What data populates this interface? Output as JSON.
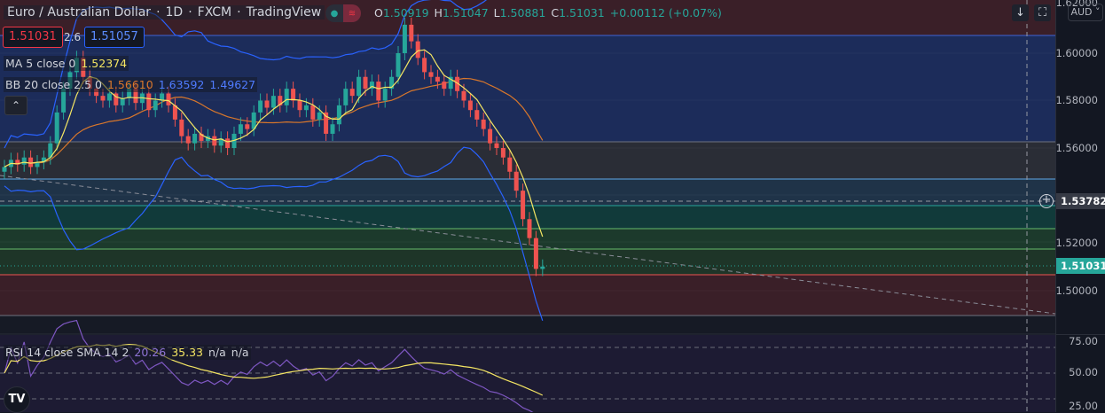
{
  "header": {
    "symbol": "Euro / Australian Dollar",
    "interval": "1D",
    "exchange": "FXCM",
    "source": "TradingView",
    "ohlc": {
      "o_label": "O",
      "o": "1.50919",
      "h_label": "H",
      "h": "1.51047",
      "l_label": "L",
      "l": "1.50881",
      "c_label": "C",
      "c": "1.51031",
      "change": "+0.00112 (+0.07%)"
    }
  },
  "trade": {
    "sell": "1.51031",
    "spread": "2.6",
    "buy": "1.51057"
  },
  "indicators": {
    "ma": {
      "label": "MA 5 close 0",
      "value": "1.52374"
    },
    "bb": {
      "label": "BB 20 close 2.5 0",
      "basis": "1.56610",
      "upper": "1.63592",
      "lower": "1.49627"
    },
    "rsi": {
      "label": "RSI 14 close SMA 14 2",
      "rsi": "20.26",
      "sma": "35.33",
      "extra1": "n/a",
      "extra2": "n/a"
    }
  },
  "price_axis": {
    "ticks": [
      "1.62000",
      "1.60000",
      "1.58000",
      "1.56000",
      "1.52000",
      "1.50000"
    ],
    "crosshair_price": "1.53782",
    "last_price": "1.51031",
    "currency": "AUD"
  },
  "rsi_axis": {
    "ticks": [
      "75.00",
      "50.00",
      "25.00"
    ]
  },
  "controls": {
    "collapse": "⌃",
    "scroll_down": "↓",
    "fullscreen": "⛶",
    "add": "+"
  },
  "logo": "TV",
  "colors": {
    "up": "#26a69a",
    "down": "#ef5350",
    "ma": "#f5e663",
    "bb_basis": "#d9772b",
    "bb_band": "#2962ff",
    "rsi": "#7e57c2",
    "rsi_sma": "#f5e663"
  },
  "chart_data": {
    "type": "candlestick",
    "y_range": [
      1.48,
      1.62
    ],
    "closes": [
      1.552,
      1.555,
      1.553,
      1.556,
      1.552,
      1.554,
      1.556,
      1.562,
      1.575,
      1.585,
      1.592,
      1.598,
      1.59,
      1.585,
      1.582,
      1.58,
      1.583,
      1.578,
      1.581,
      1.585,
      1.579,
      1.583,
      1.576,
      1.58,
      1.583,
      1.578,
      1.572,
      1.565,
      1.562,
      1.566,
      1.563,
      1.565,
      1.561,
      1.564,
      1.56,
      1.566,
      1.57,
      1.568,
      1.575,
      1.58,
      1.577,
      1.582,
      1.578,
      1.585,
      1.58,
      1.576,
      1.578,
      1.572,
      1.575,
      1.566,
      1.57,
      1.578,
      1.585,
      1.582,
      1.59,
      1.585,
      1.588,
      1.58,
      1.585,
      1.59,
      1.6,
      1.612,
      1.605,
      1.598,
      1.592,
      1.59,
      1.588,
      1.585,
      1.59,
      1.584,
      1.58,
      1.576,
      1.572,
      1.568,
      1.562,
      1.56,
      1.556,
      1.55,
      1.542,
      1.53,
      1.522,
      1.509,
      1.51
    ]
  }
}
